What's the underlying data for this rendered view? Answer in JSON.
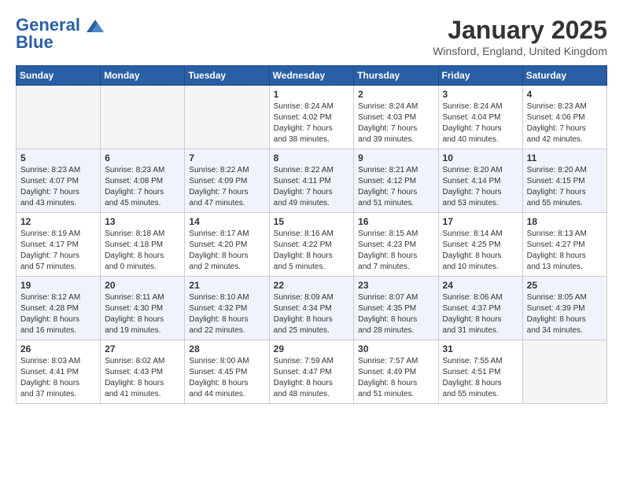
{
  "header": {
    "logo_line1": "General",
    "logo_line2": "Blue",
    "month": "January 2025",
    "location": "Winsford, England, United Kingdom"
  },
  "weekdays": [
    "Sunday",
    "Monday",
    "Tuesday",
    "Wednesday",
    "Thursday",
    "Friday",
    "Saturday"
  ],
  "weeks": [
    [
      {
        "day": "",
        "info": ""
      },
      {
        "day": "",
        "info": ""
      },
      {
        "day": "",
        "info": ""
      },
      {
        "day": "1",
        "info": "Sunrise: 8:24 AM\nSunset: 4:02 PM\nDaylight: 7 hours\nand 38 minutes."
      },
      {
        "day": "2",
        "info": "Sunrise: 8:24 AM\nSunset: 4:03 PM\nDaylight: 7 hours\nand 39 minutes."
      },
      {
        "day": "3",
        "info": "Sunrise: 8:24 AM\nSunset: 4:04 PM\nDaylight: 7 hours\nand 40 minutes."
      },
      {
        "day": "4",
        "info": "Sunrise: 8:23 AM\nSunset: 4:06 PM\nDaylight: 7 hours\nand 42 minutes."
      }
    ],
    [
      {
        "day": "5",
        "info": "Sunrise: 8:23 AM\nSunset: 4:07 PM\nDaylight: 7 hours\nand 43 minutes."
      },
      {
        "day": "6",
        "info": "Sunrise: 8:23 AM\nSunset: 4:08 PM\nDaylight: 7 hours\nand 45 minutes."
      },
      {
        "day": "7",
        "info": "Sunrise: 8:22 AM\nSunset: 4:09 PM\nDaylight: 7 hours\nand 47 minutes."
      },
      {
        "day": "8",
        "info": "Sunrise: 8:22 AM\nSunset: 4:11 PM\nDaylight: 7 hours\nand 49 minutes."
      },
      {
        "day": "9",
        "info": "Sunrise: 8:21 AM\nSunset: 4:12 PM\nDaylight: 7 hours\nand 51 minutes."
      },
      {
        "day": "10",
        "info": "Sunrise: 8:20 AM\nSunset: 4:14 PM\nDaylight: 7 hours\nand 53 minutes."
      },
      {
        "day": "11",
        "info": "Sunrise: 8:20 AM\nSunset: 4:15 PM\nDaylight: 7 hours\nand 55 minutes."
      }
    ],
    [
      {
        "day": "12",
        "info": "Sunrise: 8:19 AM\nSunset: 4:17 PM\nDaylight: 7 hours\nand 57 minutes."
      },
      {
        "day": "13",
        "info": "Sunrise: 8:18 AM\nSunset: 4:18 PM\nDaylight: 8 hours\nand 0 minutes."
      },
      {
        "day": "14",
        "info": "Sunrise: 8:17 AM\nSunset: 4:20 PM\nDaylight: 8 hours\nand 2 minutes."
      },
      {
        "day": "15",
        "info": "Sunrise: 8:16 AM\nSunset: 4:22 PM\nDaylight: 8 hours\nand 5 minutes."
      },
      {
        "day": "16",
        "info": "Sunrise: 8:15 AM\nSunset: 4:23 PM\nDaylight: 8 hours\nand 7 minutes."
      },
      {
        "day": "17",
        "info": "Sunrise: 8:14 AM\nSunset: 4:25 PM\nDaylight: 8 hours\nand 10 minutes."
      },
      {
        "day": "18",
        "info": "Sunrise: 8:13 AM\nSunset: 4:27 PM\nDaylight: 8 hours\nand 13 minutes."
      }
    ],
    [
      {
        "day": "19",
        "info": "Sunrise: 8:12 AM\nSunset: 4:28 PM\nDaylight: 8 hours\nand 16 minutes."
      },
      {
        "day": "20",
        "info": "Sunrise: 8:11 AM\nSunset: 4:30 PM\nDaylight: 8 hours\nand 19 minutes."
      },
      {
        "day": "21",
        "info": "Sunrise: 8:10 AM\nSunset: 4:32 PM\nDaylight: 8 hours\nand 22 minutes."
      },
      {
        "day": "22",
        "info": "Sunrise: 8:09 AM\nSunset: 4:34 PM\nDaylight: 8 hours\nand 25 minutes."
      },
      {
        "day": "23",
        "info": "Sunrise: 8:07 AM\nSunset: 4:35 PM\nDaylight: 8 hours\nand 28 minutes."
      },
      {
        "day": "24",
        "info": "Sunrise: 8:06 AM\nSunset: 4:37 PM\nDaylight: 8 hours\nand 31 minutes."
      },
      {
        "day": "25",
        "info": "Sunrise: 8:05 AM\nSunset: 4:39 PM\nDaylight: 8 hours\nand 34 minutes."
      }
    ],
    [
      {
        "day": "26",
        "info": "Sunrise: 8:03 AM\nSunset: 4:41 PM\nDaylight: 8 hours\nand 37 minutes."
      },
      {
        "day": "27",
        "info": "Sunrise: 8:02 AM\nSunset: 4:43 PM\nDaylight: 8 hours\nand 41 minutes."
      },
      {
        "day": "28",
        "info": "Sunrise: 8:00 AM\nSunset: 4:45 PM\nDaylight: 8 hours\nand 44 minutes."
      },
      {
        "day": "29",
        "info": "Sunrise: 7:59 AM\nSunset: 4:47 PM\nDaylight: 8 hours\nand 48 minutes."
      },
      {
        "day": "30",
        "info": "Sunrise: 7:57 AM\nSunset: 4:49 PM\nDaylight: 8 hours\nand 51 minutes."
      },
      {
        "day": "31",
        "info": "Sunrise: 7:55 AM\nSunset: 4:51 PM\nDaylight: 8 hours\nand 55 minutes."
      },
      {
        "day": "",
        "info": ""
      }
    ]
  ]
}
